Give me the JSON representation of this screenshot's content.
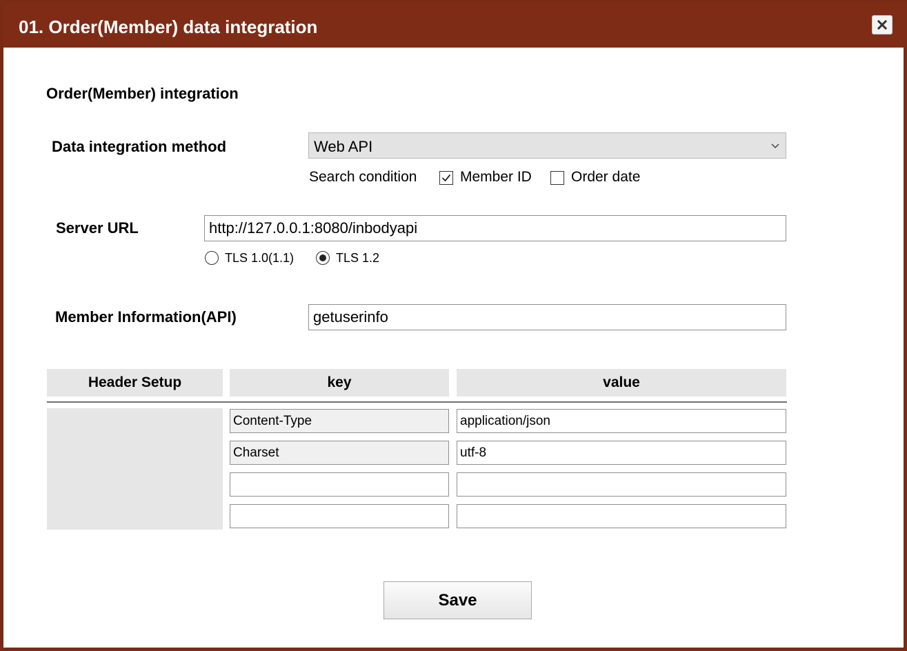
{
  "window": {
    "title": "01. Order(Member) data integration",
    "close_icon": "close-icon"
  },
  "section": {
    "title": "Order(Member) integration"
  },
  "integration_method": {
    "label": "Data integration method",
    "selected": "Web API",
    "options": [
      "Web API"
    ]
  },
  "search_condition": {
    "label": "Search condition",
    "member_id": {
      "label": "Member ID",
      "checked": true
    },
    "order_date": {
      "label": "Order date",
      "checked": false
    }
  },
  "server_url": {
    "label": "Server URL",
    "value": "http://127.0.0.1:8080/inbodyapi",
    "tls_old_label": "TLS 1.0(1.1)",
    "tls_new_label": "TLS 1.2",
    "selected_tls": "TLS 1.2"
  },
  "member_info": {
    "label": "Member Information(API)",
    "value": "getuserinfo"
  },
  "header_setup": {
    "col_label": "Header Setup",
    "col_key": "key",
    "col_value": "value",
    "rows": [
      {
        "key": "Content-Type",
        "value": "application/json"
      },
      {
        "key": "Charset",
        "value": "utf-8"
      },
      {
        "key": "",
        "value": ""
      },
      {
        "key": "",
        "value": ""
      }
    ]
  },
  "actions": {
    "save_label": "Save"
  },
  "colors": {
    "titlebar": "#7f2c17",
    "header_cell": "#e6e6e6"
  }
}
